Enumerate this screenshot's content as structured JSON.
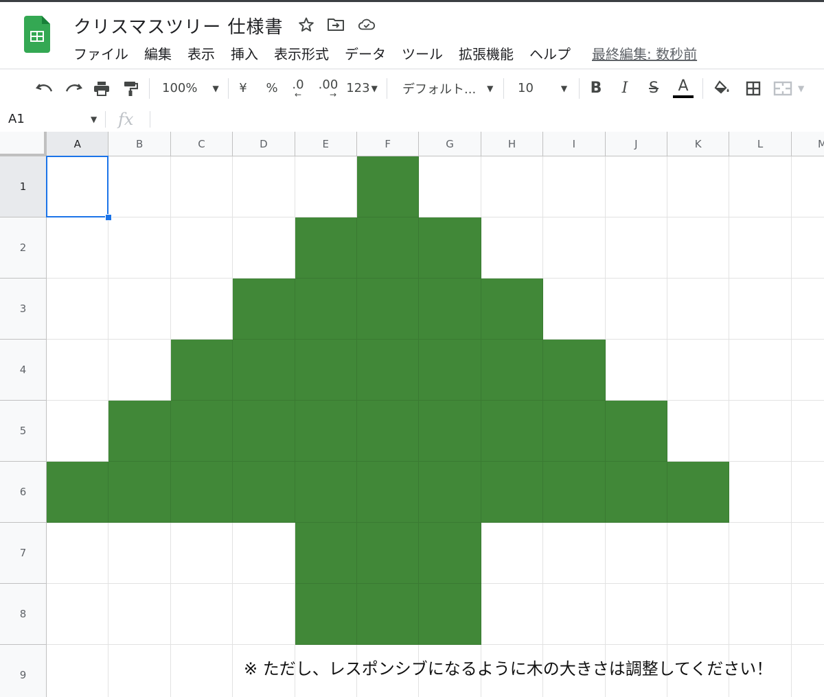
{
  "document": {
    "title": "クリスマスツリー 仕様書",
    "last_edit": "最終編集: 数秒前"
  },
  "menu": [
    "ファイル",
    "編集",
    "表示",
    "挿入",
    "表示形式",
    "データ",
    "ツール",
    "拡張機能",
    "ヘルプ"
  ],
  "toolbar": {
    "zoom": "100%",
    "currency": "¥",
    "percent": "%",
    "decrease_decimal": ".0",
    "increase_decimal": ".00",
    "more_formats": "123",
    "font": "デフォルト...",
    "font_size": "10",
    "bold": "B",
    "italic": "I",
    "strike": "S",
    "text_color": "A"
  },
  "formula_bar": {
    "name_box": "A1",
    "fx": "fx"
  },
  "columns": [
    "A",
    "B",
    "C",
    "D",
    "E",
    "F",
    "G",
    "H",
    "I",
    "J",
    "K",
    "L",
    "M"
  ],
  "rows": [
    "1",
    "2",
    "3",
    "4",
    "5",
    "6",
    "7",
    "8",
    "9"
  ],
  "selected_cell": "A1",
  "fill_color": "#418838",
  "filled_cells": {
    "1": [
      "F"
    ],
    "2": [
      "E",
      "F",
      "G"
    ],
    "3": [
      "D",
      "E",
      "F",
      "G",
      "H"
    ],
    "4": [
      "C",
      "D",
      "E",
      "F",
      "G",
      "H",
      "I"
    ],
    "5": [
      "B",
      "C",
      "D",
      "E",
      "F",
      "G",
      "H",
      "I",
      "J"
    ],
    "6": [
      "A",
      "B",
      "C",
      "D",
      "E",
      "F",
      "G",
      "H",
      "I",
      "J",
      "K"
    ],
    "7": [
      "E",
      "F",
      "G"
    ],
    "8": [
      "E",
      "F",
      "G"
    ]
  },
  "note": "※ ただし、レスポンシブになるように木の大きさは調整してください！"
}
